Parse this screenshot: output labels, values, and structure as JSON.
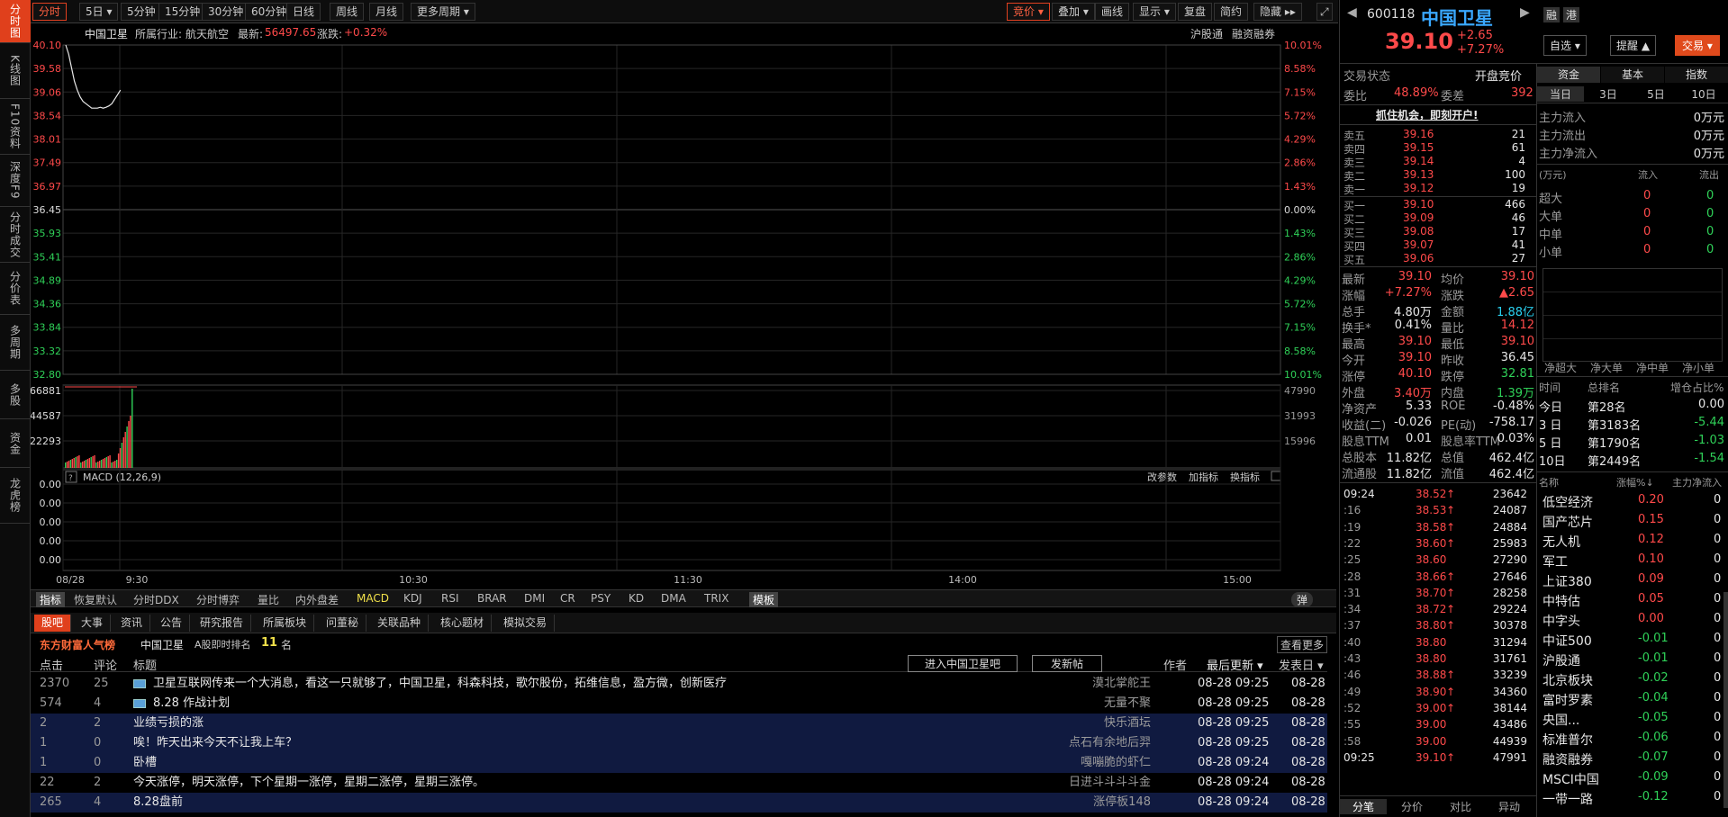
{
  "left_tabs": [
    "分时图",
    "K线图",
    "F10资料",
    "深度F9",
    "分时成交",
    "分价表",
    "多周期",
    "多股",
    "资金",
    "龙虎榜"
  ],
  "toolbar": {
    "items": [
      "分时",
      "5日 ▾",
      "5分钟",
      "15分钟",
      "30分钟",
      "60分钟",
      "日线",
      "周线",
      "月线",
      "更多周期 ▾"
    ],
    "right_items": [
      "竞价 ▾",
      "叠加 ▾",
      "画线",
      "显示 ▾",
      "复盘",
      "简约",
      "隐藏 ▸▸"
    ]
  },
  "chart_header": {
    "name": "中国卫星",
    "industry_label": "所属行业:",
    "industry": "航天航空",
    "latest_label": "最新:",
    "latest": "56497.65",
    "change_label": "涨跌:",
    "change": "+0.32%",
    "link1": "沪股通",
    "link2": "融资融券"
  },
  "chart_data": {
    "type": "line",
    "y_left_ticks": [
      "40.10",
      "39.58",
      "39.06",
      "38.54",
      "38.01",
      "37.49",
      "36.97",
      "36.45",
      "35.93",
      "35.41",
      "34.89",
      "34.36",
      "33.84",
      "33.32",
      "32.80"
    ],
    "y_right_ticks": [
      "10.01%",
      "8.58%",
      "7.15%",
      "5.72%",
      "4.29%",
      "2.86%",
      "1.43%",
      "0.00%",
      "1.43%",
      "2.86%",
      "4.29%",
      "5.72%",
      "7.15%",
      "8.58%",
      "10.01%"
    ],
    "x_ticks": [
      "08/28",
      "9:30",
      "10:30",
      "11:30",
      "14:00",
      "15:00"
    ],
    "price": [
      40.1,
      39.9,
      39.6,
      39.3,
      39.1,
      38.95,
      38.85,
      38.8,
      38.75,
      38.7,
      38.7,
      38.7,
      38.72,
      38.7,
      38.72,
      38.75,
      38.8,
      38.9,
      39.0,
      39.1
    ],
    "volume_ticks_left": [
      "66881",
      "44587",
      "22293"
    ],
    "volume_ticks_right": [
      "47990",
      "31993",
      "15996"
    ],
    "macd_label": "MACD (12,26,9)",
    "macd_ticks": [
      "0.00",
      "0.00",
      "0.00",
      "0.00",
      "0.00"
    ],
    "macd_links": [
      "改参数",
      "加指标",
      "换指标"
    ]
  },
  "indicator_bar": [
    "指标",
    "恢复默认",
    "分时DDX",
    "分时博弈",
    "量比",
    "内外盘差",
    "MACD",
    "KDJ",
    "RSI",
    "BRAR",
    "DMI",
    "CR",
    "PSY",
    "KD",
    "DMA",
    "TRIX",
    "模板"
  ],
  "indicator_toggle": "弹",
  "news": {
    "tabs": [
      "股吧",
      "大事",
      "资讯",
      "公告",
      "研究报告",
      "所属板块",
      "问董秘",
      "关联品种",
      "核心题材",
      "模拟交易"
    ],
    "rank_title": "东方财富人气榜",
    "rank_stock": "中国卫星",
    "rank_label": "A股即时排名",
    "rank": "11",
    "rank_unit": "名",
    "more": "查看更多",
    "col_clicks": "点击",
    "col_comments": "评论",
    "col_title": "标题",
    "btn_enter": "进入中国卫星吧",
    "btn_post": "发新帖",
    "col_author": "作者",
    "col_updated": "最后更新 ▾",
    "col_posted": "发表日 ▾",
    "rows": [
      {
        "clicks": "2370",
        "comments": "25",
        "title": "卫星互联网传来一个大消息，看这一只就够了，中国卫星，科森科技，歌尔股份，拓维信息，盈方微，创新医疗",
        "author": "漠北掌舵王",
        "updated": "08-28 09:25",
        "posted": "08-28",
        "icon": true,
        "hi": false
      },
      {
        "clicks": "574",
        "comments": "4",
        "title": "8.28    作战计划",
        "author": "无量不聚",
        "updated": "08-28 09:25",
        "posted": "08-28",
        "icon": true,
        "hi": false
      },
      {
        "clicks": "2",
        "comments": "2",
        "title": "业绩亏损的涨",
        "author": "快乐酒坛",
        "updated": "08-28 09:25",
        "posted": "08-28",
        "icon": false,
        "hi": true
      },
      {
        "clicks": "1",
        "comments": "0",
        "title": "唉！昨天出来今天不让我上车？",
        "author": "点石有余地后羿",
        "updated": "08-28 09:25",
        "posted": "08-28",
        "icon": false,
        "hi": true
      },
      {
        "clicks": "1",
        "comments": "0",
        "title": "卧槽",
        "author": "嘎嘣脆的虾仁",
        "updated": "08-28 09:24",
        "posted": "08-28",
        "icon": false,
        "hi": true
      },
      {
        "clicks": "22",
        "comments": "2",
        "title": "今天涨停，明天涨停，下个星期一涨停，星期二涨停，星期三涨停。",
        "author": "日进斗斗斗斗金",
        "updated": "08-28 09:24",
        "posted": "08-28",
        "icon": false,
        "hi": false
      },
      {
        "clicks": "265",
        "comments": "4",
        "title": "8.28盘前",
        "author": "涨停板148",
        "updated": "08-28 09:24",
        "posted": "08-28",
        "icon": false,
        "hi": true
      }
    ]
  },
  "quote": {
    "code": "600118",
    "name": "中国卫星",
    "tag1": "融",
    "tag2": "港",
    "price": "39.10",
    "chg": "+2.65",
    "pct": "+7.27%",
    "btn_watch": "自选 ▾",
    "btn_alert": "提醒 ▲",
    "btn_trade": "交易 ▾",
    "status_label": "交易状态",
    "status": "开盘竞价",
    "wb_label": "委比",
    "wb": "48.89%",
    "wc_label": "委差",
    "wc": "392",
    "promo": "抓住机会，即刻开户!",
    "asks": [
      {
        "label": "卖五",
        "price": "39.16",
        "vol": "21"
      },
      {
        "label": "卖四",
        "price": "39.15",
        "vol": "61"
      },
      {
        "label": "卖三",
        "price": "39.14",
        "vol": "4"
      },
      {
        "label": "卖二",
        "price": "39.13",
        "vol": "100"
      },
      {
        "label": "卖一",
        "price": "39.12",
        "vol": "19"
      }
    ],
    "bids": [
      {
        "label": "买一",
        "price": "39.10",
        "vol": "466"
      },
      {
        "label": "买二",
        "price": "39.09",
        "vol": "46"
      },
      {
        "label": "买三",
        "price": "39.08",
        "vol": "17"
      },
      {
        "label": "买四",
        "price": "39.07",
        "vol": "41"
      },
      {
        "label": "买五",
        "price": "39.06",
        "vol": "27"
      }
    ],
    "stats": [
      {
        "l1": "最新",
        "v1": "39.10",
        "c1": "red",
        "l2": "均价",
        "v2": "39.10",
        "c2": "red"
      },
      {
        "l1": "涨幅",
        "v1": "+7.27%",
        "c1": "red",
        "l2": "涨跌",
        "v2": "▲2.65",
        "c2": "red"
      },
      {
        "l1": "总手",
        "v1": "4.80万",
        "c1": "white",
        "l2": "金额",
        "v2": "1.88亿",
        "c2": "cyan"
      },
      {
        "l1": "换手*",
        "v1": "0.41%",
        "c1": "white",
        "l2": "量比",
        "v2": "14.12",
        "c2": "red"
      },
      {
        "l1": "最高",
        "v1": "39.10",
        "c1": "red",
        "l2": "最低",
        "v2": "39.10",
        "c2": "red"
      },
      {
        "l1": "今开",
        "v1": "39.10",
        "c1": "red",
        "l2": "昨收",
        "v2": "36.45",
        "c2": "white"
      },
      {
        "l1": "涨停",
        "v1": "40.10",
        "c1": "red",
        "l2": "跌停",
        "v2": "32.81",
        "c2": "green"
      },
      {
        "l1": "外盘",
        "v1": "3.40万",
        "c1": "red",
        "l2": "内盘",
        "v2": "1.39万",
        "c2": "green"
      },
      {
        "l1": "净资产",
        "v1": "5.33",
        "c1": "white",
        "l2": "ROE",
        "v2": "-0.48%",
        "c2": "white"
      },
      {
        "l1": "收益(二)",
        "v1": "-0.026",
        "c1": "white",
        "l2": "PE(动)",
        "v2": "-758.17",
        "c2": "white"
      },
      {
        "l1": "股息TTM",
        "v1": "0.01",
        "c1": "white",
        "l2": "股息率TTM",
        "v2": "0.03%",
        "c2": "white"
      },
      {
        "l1": "总股本",
        "v1": "11.82亿",
        "c1": "white",
        "l2": "总值",
        "v2": "462.4亿",
        "c2": "white"
      },
      {
        "l1": "流通股",
        "v1": "11.82亿",
        "c1": "white",
        "l2": "流值",
        "v2": "462.4亿",
        "c2": "white"
      }
    ],
    "ticks": [
      {
        "t": "09:24",
        "p": "38.52",
        "a": "↑",
        "v": "23642"
      },
      {
        "t": ":16",
        "p": "38.53",
        "a": "↑",
        "v": "24087"
      },
      {
        "t": ":19",
        "p": "38.58",
        "a": "↑",
        "v": "24884"
      },
      {
        "t": ":22",
        "p": "38.60",
        "a": "↑",
        "v": "25983"
      },
      {
        "t": ":25",
        "p": "38.60",
        "a": "",
        "v": "27290"
      },
      {
        "t": ":28",
        "p": "38.66",
        "a": "↑",
        "v": "27646"
      },
      {
        "t": ":31",
        "p": "38.70",
        "a": "↑",
        "v": "28258"
      },
      {
        "t": ":34",
        "p": "38.72",
        "a": "↑",
        "v": "29224"
      },
      {
        "t": ":37",
        "p": "38.80",
        "a": "↑",
        "v": "30378"
      },
      {
        "t": ":40",
        "p": "38.80",
        "a": "",
        "v": "31294"
      },
      {
        "t": ":43",
        "p": "38.80",
        "a": "",
        "v": "31761"
      },
      {
        "t": ":46",
        "p": "38.88",
        "a": "↑",
        "v": "33239"
      },
      {
        "t": ":49",
        "p": "38.90",
        "a": "↑",
        "v": "34360"
      },
      {
        "t": ":52",
        "p": "39.00",
        "a": "↑",
        "v": "38144"
      },
      {
        "t": ":55",
        "p": "39.00",
        "a": "",
        "v": "43486"
      },
      {
        "t": ":58",
        "p": "39.00",
        "a": "",
        "v": "44939"
      },
      {
        "t": "09:25",
        "p": "39.10",
        "a": "↑",
        "v": "47991"
      }
    ],
    "tick_tabs": [
      "分笔",
      "分价",
      "对比",
      "异动"
    ]
  },
  "fund": {
    "tabs": [
      "资金",
      "基本",
      "指数"
    ],
    "subtabs": [
      "当日",
      "3日",
      "5日",
      "10日"
    ],
    "flows": [
      {
        "l": "主力流入",
        "v": "0万元"
      },
      {
        "l": "主力流出",
        "v": "0万元"
      },
      {
        "l": "主力净流入",
        "v": "0万元"
      }
    ],
    "unit": "(万元)",
    "col_in": "流入",
    "col_out": "流出",
    "sizes": [
      {
        "l": "超大",
        "in": "0",
        "out": "0"
      },
      {
        "l": "大单",
        "in": "0",
        "out": "0"
      },
      {
        "l": "中单",
        "in": "0",
        "out": "0"
      },
      {
        "l": "小单",
        "in": "0",
        "out": "0"
      }
    ],
    "net_labels": [
      "净超大",
      "净大单",
      "净中单",
      "净小单"
    ],
    "rank_head": [
      "时间",
      "总排名",
      "增仓占比%"
    ],
    "ranks": [
      {
        "t": "今日",
        "r": "第28名",
        "p": "0.00"
      },
      {
        "t": "3 日",
        "r": "第3183名",
        "p": "-5.44"
      },
      {
        "t": "5 日",
        "r": "第1790名",
        "p": "-1.03"
      },
      {
        "t": "10日",
        "r": "第2449名",
        "p": "-1.54"
      }
    ],
    "sector_head": [
      "名称",
      "涨幅%↓",
      "主力净流入"
    ],
    "sectors": [
      {
        "n": "低空经济",
        "p": "0.20",
        "f": "0"
      },
      {
        "n": "国产芯片",
        "p": "0.15",
        "f": "0"
      },
      {
        "n": "无人机",
        "p": "0.12",
        "f": "0"
      },
      {
        "n": "军工",
        "p": "0.10",
        "f": "0"
      },
      {
        "n": "上证380",
        "p": "0.09",
        "f": "0"
      },
      {
        "n": "中特估",
        "p": "0.05",
        "f": "0"
      },
      {
        "n": "中字头",
        "p": "0.00",
        "f": "0"
      },
      {
        "n": "中证500",
        "p": "-0.01",
        "f": "0"
      },
      {
        "n": "沪股通",
        "p": "-0.01",
        "f": "0"
      },
      {
        "n": "北京板块",
        "p": "-0.02",
        "f": "0"
      },
      {
        "n": "富时罗素",
        "p": "-0.04",
        "f": "0"
      },
      {
        "n": "央国...",
        "p": "-0.05",
        "f": "0"
      },
      {
        "n": "标准普尔",
        "p": "-0.06",
        "f": "0"
      },
      {
        "n": "融资融券",
        "p": "-0.07",
        "f": "0"
      },
      {
        "n": "MSCI中国",
        "p": "-0.09",
        "f": "0"
      },
      {
        "n": "一带一路",
        "p": "-0.12",
        "f": "0"
      }
    ]
  }
}
